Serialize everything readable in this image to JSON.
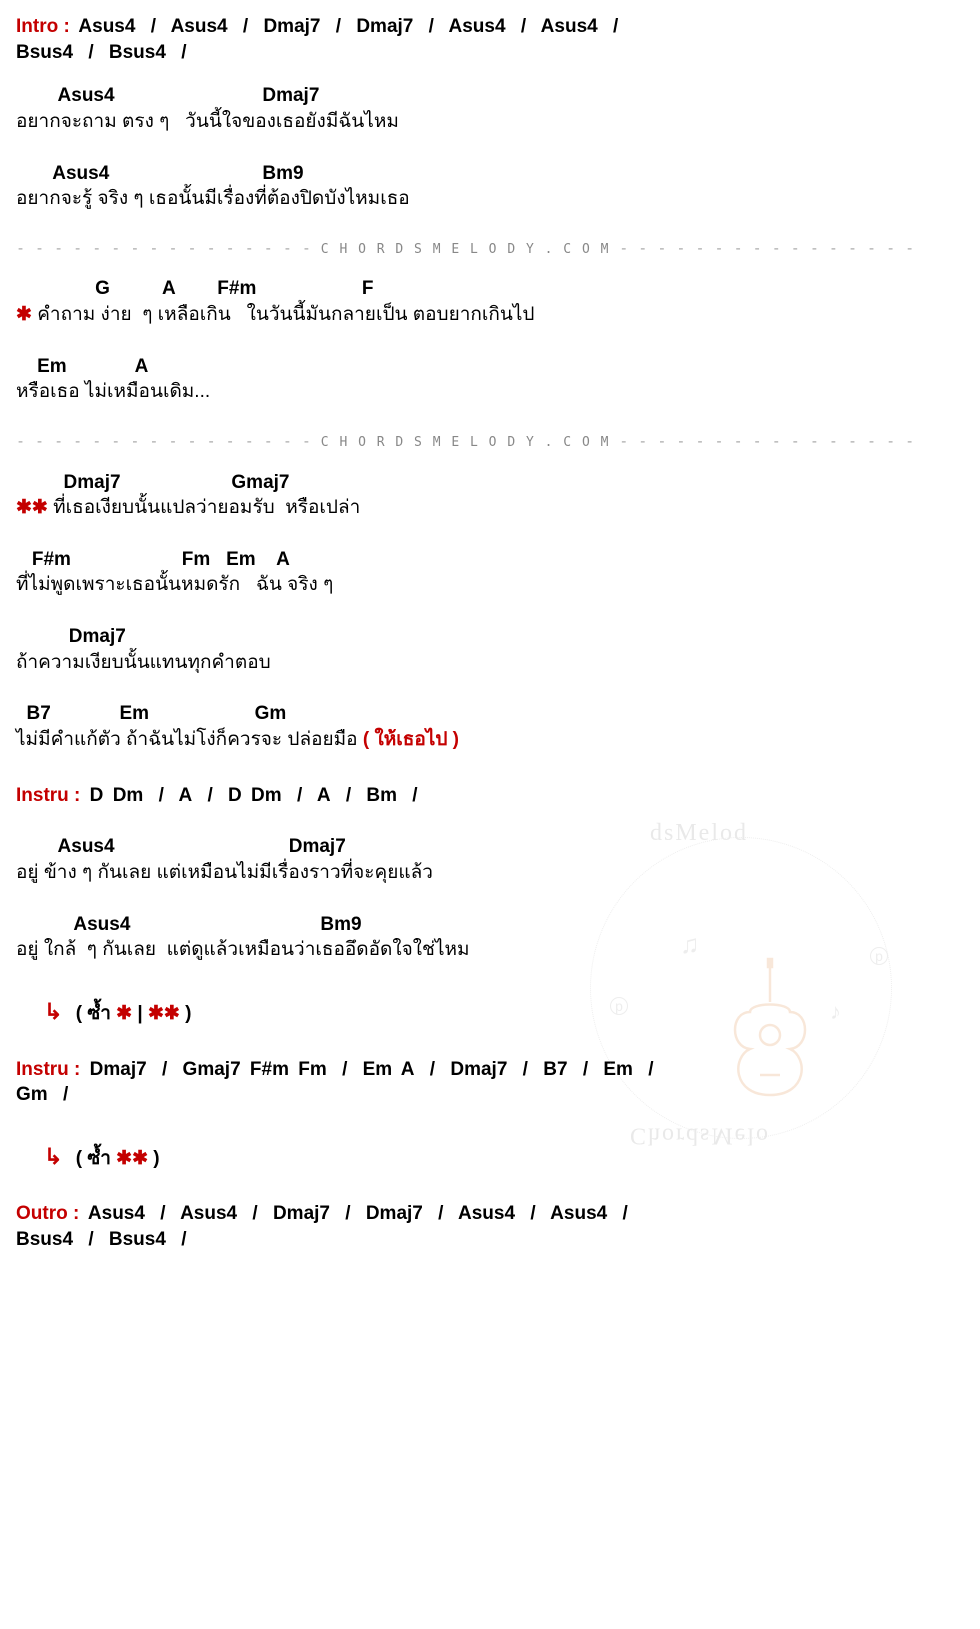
{
  "intro": {
    "label": "Intro :",
    "chords": [
      "Asus4",
      "/",
      "Asus4",
      "/",
      "Dmaj7",
      "/",
      "Dmaj7",
      "/",
      "Asus4",
      "/",
      "Asus4",
      "/",
      "Bsus4",
      "/",
      "Bsus4",
      "/"
    ]
  },
  "verse1a": {
    "chord_line1": "        Asus4                            Dmaj7",
    "lyric_line1": "อยากจะถาม ตรง ๆ   วันนี้ใจของเธอยังมีฉันไหม",
    "chord_line2": "       Asus4                             Bm9",
    "lyric_line2": "อยากจะรู้ จริง ๆ เธอนั้นมีเรื่องที่ต้องปิดบังไหมเธอ"
  },
  "divider": {
    "left": "- - - - - - - - - - - - - - - -",
    "mid": " C H O R D S M E L O D Y . C O M ",
    "right": "- - - - - - - - - - - - - - - -"
  },
  "prechorus": {
    "chord_line1": "               G          A        F#m                    F",
    "lyric_line1_star": "✱",
    "lyric_line1": " คำถาม ง่าย  ๆ เหลือเกิน   ในวันนี้มันกลายเป็น ตอบยากเกินไป",
    "chord_line2": "    Em             A",
    "lyric_line2": "หรือเธอ ไม่เหมือนเดิม..."
  },
  "chorus": {
    "chord_line1": "         Dmaj7                     Gmaj7",
    "lyric_line1_star": "✱✱",
    "lyric_line1": " ที่เธอเงียบนั้นแปลว่ายอมรับ  หรือเปล่า",
    "chord_line2": "   F#m                     Fm   Em    A",
    "lyric_line2": "ที่ไม่พูดเพราะเธอนั้นหมดรัก   ฉัน จริง ๆ",
    "chord_line3": "          Dmaj7",
    "lyric_line3": "ถ้าความเงียบนั้นแทนทุกคำตอบ",
    "chord_line4": "  B7             Em                    Gm",
    "lyric_line4": "ไม่มีคำแก้ตัว ถ้าฉันไม่โง่ก็ควรจะ ปล่อยมือ",
    "lyric_line4_red": " ( ให้เธอไป )"
  },
  "instru1": {
    "label": "Instru :",
    "chords": [
      "D",
      "Dm",
      "/",
      "A",
      "/",
      "D",
      "Dm",
      "/",
      "A",
      "/",
      "Bm",
      "/"
    ]
  },
  "verse2": {
    "chord_line1": "        Asus4                                 Dmaj7",
    "lyric_line1": "อยู่ ข้าง ๆ กันเลย แต่เหมือนไม่มีเรื่องราวที่จะคุยแล้ว",
    "chord_line2": "           Asus4                                    Bm9",
    "lyric_line2": "อยู่ ใกล้  ๆ กันเลย  แต่ดูแล้วเหมือนว่าเธออึดอัดใจใช่ไหม"
  },
  "repeat1": {
    "arrow": "↳",
    "open": "( ซ้ำ ",
    "s1": "✱",
    "bar": " | ",
    "s2": "✱✱",
    "close": " )"
  },
  "instru2": {
    "label": "Instru :",
    "chords": [
      "Dmaj7",
      "/",
      "Gmaj7",
      "F#m",
      "Fm",
      "/",
      "Em",
      "A",
      "/",
      "Dmaj7",
      "/",
      "B7",
      "/",
      "Em",
      "/",
      "Gm",
      "/"
    ]
  },
  "repeat2": {
    "arrow": "↳",
    "open": "( ซ้ำ ",
    "s1": "✱✱",
    "close": " )"
  },
  "outro": {
    "label": "Outro :",
    "chords": [
      "Asus4",
      "/",
      "Asus4",
      "/",
      "Dmaj7",
      "/",
      "Dmaj7",
      "/",
      "Asus4",
      "/",
      "Asus4",
      "/",
      "Bsus4",
      "/",
      "Bsus4",
      "/"
    ]
  },
  "watermark": {
    "top": "dsMelod",
    "bot": "ChordsMelo"
  }
}
